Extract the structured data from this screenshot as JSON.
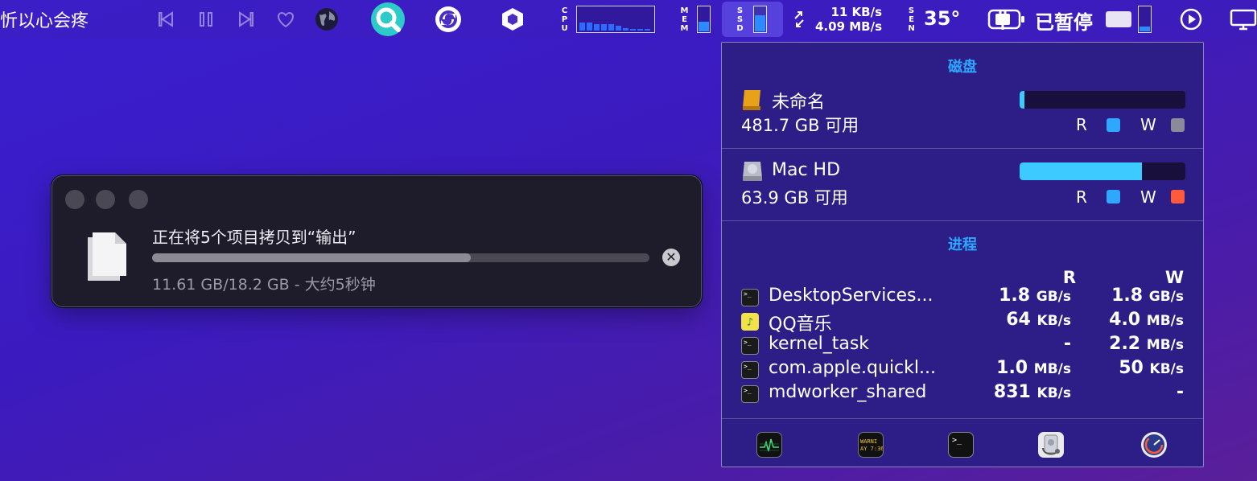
{
  "menubar": {
    "now_playing": "忻以心会疼",
    "cpu_label": "CPU",
    "mem_label": "MEM",
    "ssd_label": "SSD",
    "net_up": "11 KB/s",
    "net_down": "4.09 MB/s",
    "sensor_label": "SEN",
    "temperature": "35°",
    "paused_label": "已暂停",
    "cpu_history": [
      0.35,
      0.35,
      0.3,
      0.3,
      0.3,
      0.22,
      0.1,
      0.08,
      0.08,
      0.08
    ],
    "mem_level": 0.45,
    "ssd_level": 0.7,
    "battery_level": 0.25
  },
  "copy_dialog": {
    "title": "正在将5个项目拷贝到“输出”",
    "status": "11.61 GB/18.2 GB - 大约5秒钟",
    "progress": 0.64
  },
  "ssd_popover": {
    "disk_section_title": "磁盘",
    "disks": [
      {
        "name": "未命名",
        "free": "481.7 GB 可用",
        "usage": 0.03,
        "read_label": "R",
        "write_label": "W",
        "read_color": "#2ea8ff",
        "write_color": "#8a8a9a"
      },
      {
        "name": "Mac HD",
        "free": "63.9 GB 可用",
        "usage": 0.74,
        "read_label": "R",
        "write_label": "W",
        "read_color": "#2ea8ff",
        "write_color": "#ff5a3c"
      }
    ],
    "process_section_title": "进程",
    "col_read": "R",
    "col_write": "W",
    "processes": [
      {
        "name": "DesktopServices...",
        "read_num": "1.8",
        "read_unit": "GB/s",
        "write_num": "1.8",
        "write_unit": "GB/s"
      },
      {
        "name": "QQ音乐",
        "read_num": "64",
        "read_unit": "KB/s",
        "write_num": "4.0",
        "write_unit": "MB/s"
      },
      {
        "name": "kernel_task",
        "read_num": "-",
        "read_unit": "",
        "write_num": "2.2",
        "write_unit": "MB/s"
      },
      {
        "name": "com.apple.quickl...",
        "read_num": "1.0",
        "read_unit": "MB/s",
        "write_num": "50",
        "write_unit": "KB/s"
      },
      {
        "name": "mdworker_shared",
        "read_num": "831",
        "read_unit": "KB/s",
        "write_num": "-",
        "write_unit": ""
      }
    ],
    "bottom_apps": [
      "activity-monitor-icon",
      "console-icon",
      "terminal-icon",
      "disk-utility-icon",
      "system-information-icon"
    ],
    "console_icon_text": "WARNI\nAY 7:36"
  }
}
